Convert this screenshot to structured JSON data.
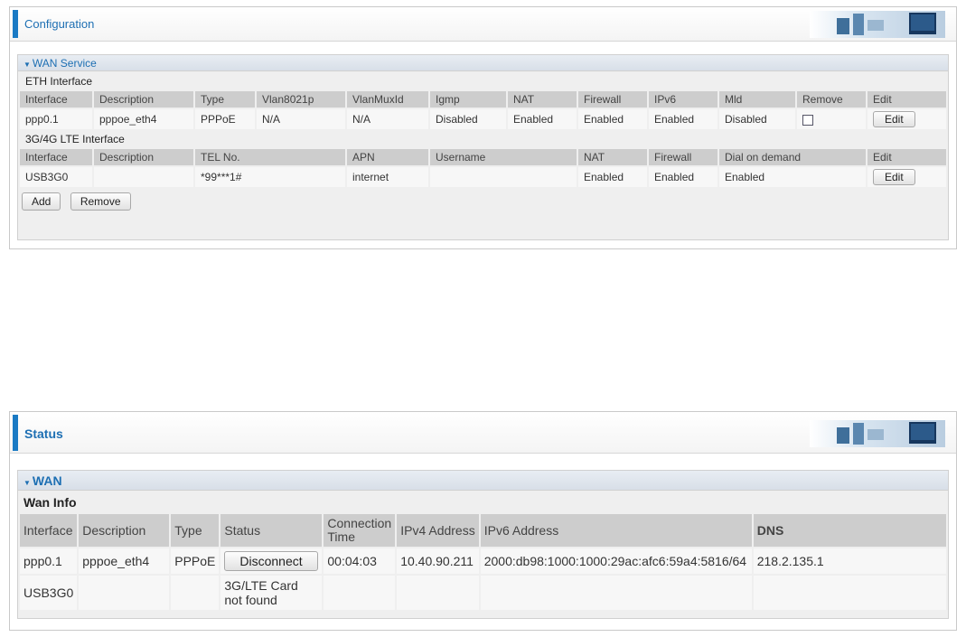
{
  "config": {
    "title": "Configuration",
    "section_label": "WAN Service",
    "eth": {
      "label": "ETH Interface",
      "headers": [
        "Interface",
        "Description",
        "Type",
        "Vlan8021p",
        "VlanMuxId",
        "Igmp",
        "NAT",
        "Firewall",
        "IPv6",
        "Mld",
        "Remove",
        "Edit"
      ],
      "rows": [
        {
          "interface": "ppp0.1",
          "description": "pppoe_eth4",
          "type": "PPPoE",
          "vlan8021p": "N/A",
          "vlanmuxid": "N/A",
          "igmp": "Disabled",
          "nat": "Enabled",
          "firewall": "Enabled",
          "ipv6": "Enabled",
          "mld": "Disabled",
          "edit": "Edit"
        }
      ]
    },
    "lte": {
      "label": "3G/4G LTE Interface",
      "headers": [
        "Interface",
        "Description",
        "TEL No.",
        "APN",
        "Username",
        "NAT",
        "Firewall",
        "Dial on demand",
        "Edit"
      ],
      "rows": [
        {
          "interface": "USB3G0",
          "description": "",
          "tel": "*99***1#",
          "apn": "internet",
          "username": "",
          "nat": "Enabled",
          "firewall": "Enabled",
          "dial": "Enabled",
          "edit": "Edit"
        }
      ]
    },
    "add_label": "Add",
    "remove_label": "Remove"
  },
  "status": {
    "title": "Status",
    "section_label": "WAN",
    "wan_info_label": "Wan Info",
    "headers": [
      "Interface",
      "Description",
      "Type",
      "Status",
      "Connection Time",
      "IPv4 Address",
      "IPv6 Address",
      "DNS"
    ],
    "rows": [
      {
        "interface": "ppp0.1",
        "description": "pppoe_eth4",
        "type": "PPPoE",
        "status": "Disconnect",
        "time": "00:04:03",
        "ipv4": "10.40.90.211",
        "ipv6": "2000:db98:1000:1000:29ac:afc6:59a4:5816/64",
        "dns": "218.2.135.1"
      },
      {
        "interface": "USB3G0",
        "description": "",
        "type": "",
        "status": "3G/LTE Card not found",
        "time": "",
        "ipv4": "",
        "ipv6": "",
        "dns": ""
      }
    ]
  },
  "colors": {
    "accent": "#1a7ac4",
    "title": "#1d6fb3",
    "header_cell": "#cdcdcd"
  },
  "icons": {
    "banner": "network-banner-graphic",
    "section_arrow": "triangle-down-icon"
  }
}
